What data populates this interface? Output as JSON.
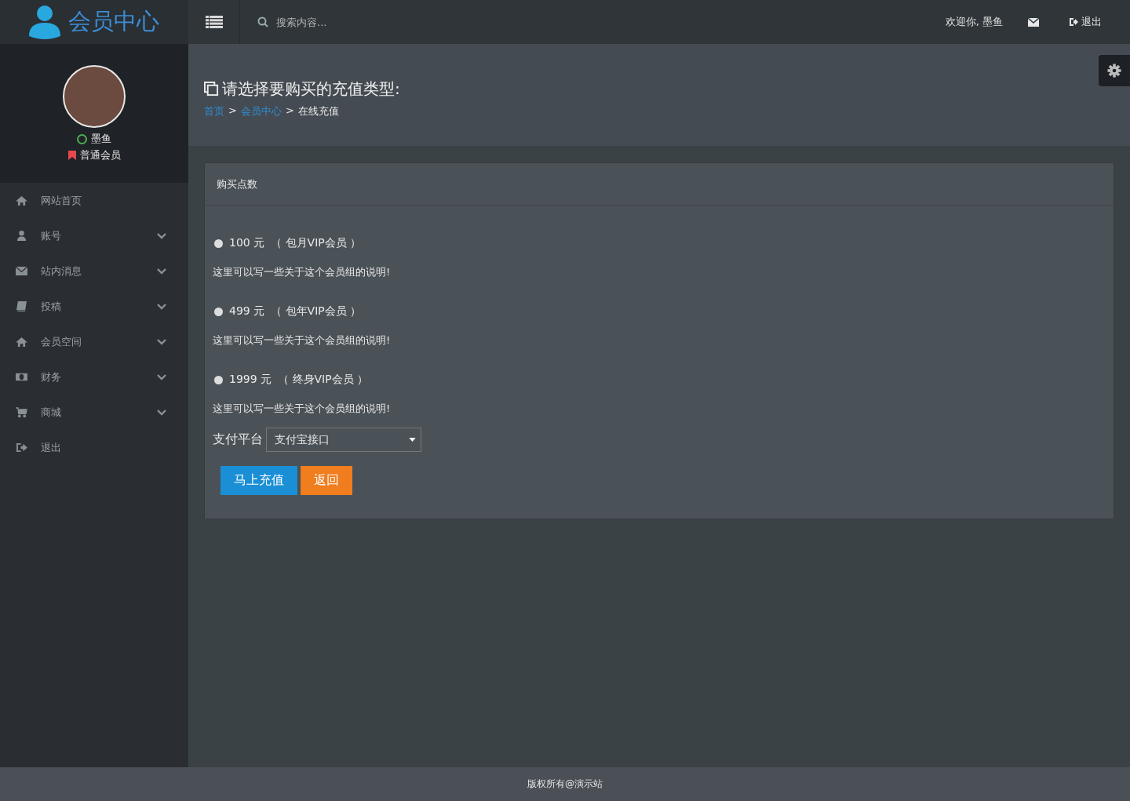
{
  "brand": {
    "title": "会员中心"
  },
  "topbar": {
    "search": {
      "placeholder": "搜索内容..."
    },
    "welcome": "欢迎你, 墨鱼",
    "logout": "退出"
  },
  "user": {
    "name": "墨鱼",
    "online": true,
    "group": "普通会员"
  },
  "sidebar": {
    "items": [
      {
        "label": "网站首页",
        "has_submenu": false
      },
      {
        "label": "账号",
        "has_submenu": true
      },
      {
        "label": "站内消息",
        "has_submenu": true
      },
      {
        "label": "投稿",
        "has_submenu": true
      },
      {
        "label": "会员空间",
        "has_submenu": true
      },
      {
        "label": "财务",
        "has_submenu": true
      },
      {
        "label": "商城",
        "has_submenu": true
      },
      {
        "label": "退出",
        "has_submenu": false
      }
    ]
  },
  "page": {
    "title": "请选择要购买的充值类型:",
    "separator": ">",
    "breadcrumb": [
      {
        "label": "首页",
        "link": true
      },
      {
        "label": "会员中心",
        "link": true
      },
      {
        "label": "在线充值",
        "link": false
      }
    ]
  },
  "panel": {
    "title": "购买点数",
    "options": [
      {
        "price": "100 元",
        "name": "（ 包月VIP会员 ）",
        "description": "这里可以写一些关于这个会员组的说明!",
        "selected": false
      },
      {
        "price": "499 元",
        "name": "（ 包年VIP会员 ）",
        "description": "这里可以写一些关于这个会员组的说明!",
        "selected": false
      },
      {
        "price": "1999 元",
        "name": "（ 终身VIP会员 ）",
        "description": "这里可以写一些关于这个会员组的说明!",
        "selected": false
      }
    ],
    "payment": {
      "label": "支付平台",
      "value": "支付宝接口"
    },
    "buttons": [
      {
        "label": "马上充值",
        "kind": "primary"
      },
      {
        "label": "返回",
        "kind": "warning"
      }
    ]
  },
  "footer": "版权所有@演示站"
}
